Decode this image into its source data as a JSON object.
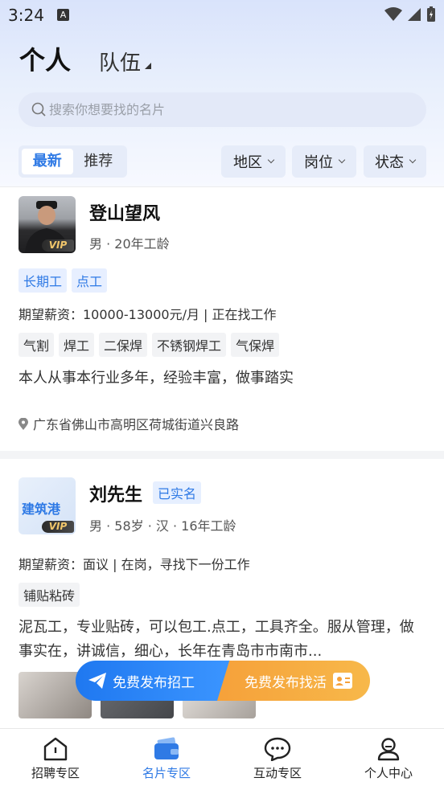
{
  "status_bar": {
    "time": "3:24",
    "a_label": "A"
  },
  "header": {
    "title": "个人",
    "subtitle": "队伍"
  },
  "search": {
    "placeholder": "搜索你想要找的名片"
  },
  "tabs": [
    {
      "label": "最新",
      "active": true
    },
    {
      "label": "推荐",
      "active": false
    }
  ],
  "filters": [
    "地区",
    "岗位",
    "状态"
  ],
  "cards": [
    {
      "name": "登山望风",
      "meta": "男 · 20年工龄",
      "vip": "VIP",
      "type_tags": [
        "长期工",
        "点工"
      ],
      "salary": "期望薪资：10000-13000元/月 | 正在找工作",
      "skills": [
        "气割",
        "焊工",
        "二保焊",
        "不锈钢焊工",
        "气保焊"
      ],
      "description": "本人从事本行业多年，经验丰富，做事踏实",
      "address": "广东省佛山市高明区荷城街道兴良路"
    },
    {
      "name": "刘先生",
      "verified": "已实名",
      "meta": "男 · 58岁 · 汉 · 16年工龄",
      "vip": "VIP",
      "logo_text": "建筑港",
      "salary": "期望薪资：面议 | 在岗，寻找下一份工作",
      "skills": [
        "铺贴粘砖"
      ],
      "description": "泥瓦工，专业贴砖，可以包工.点工，工具齐全。服从管理，做事实在，讲诚信，细心，长年在青岛市市南市..."
    }
  ],
  "float_buttons": {
    "recruit": "免费发布招工",
    "find_work": "免费发布找活"
  },
  "bottom_nav": [
    {
      "label": "招聘专区",
      "icon": "house-icon",
      "active": false
    },
    {
      "label": "名片专区",
      "icon": "wallet-card-icon",
      "active": true
    },
    {
      "label": "互动专区",
      "icon": "chat-bubble-icon",
      "active": false
    },
    {
      "label": "个人中心",
      "icon": "user-icon",
      "active": false
    }
  ],
  "colors": {
    "accent": "#2f7ae5",
    "orange": "#f6a13a",
    "tag_bg": "#e7efff"
  }
}
